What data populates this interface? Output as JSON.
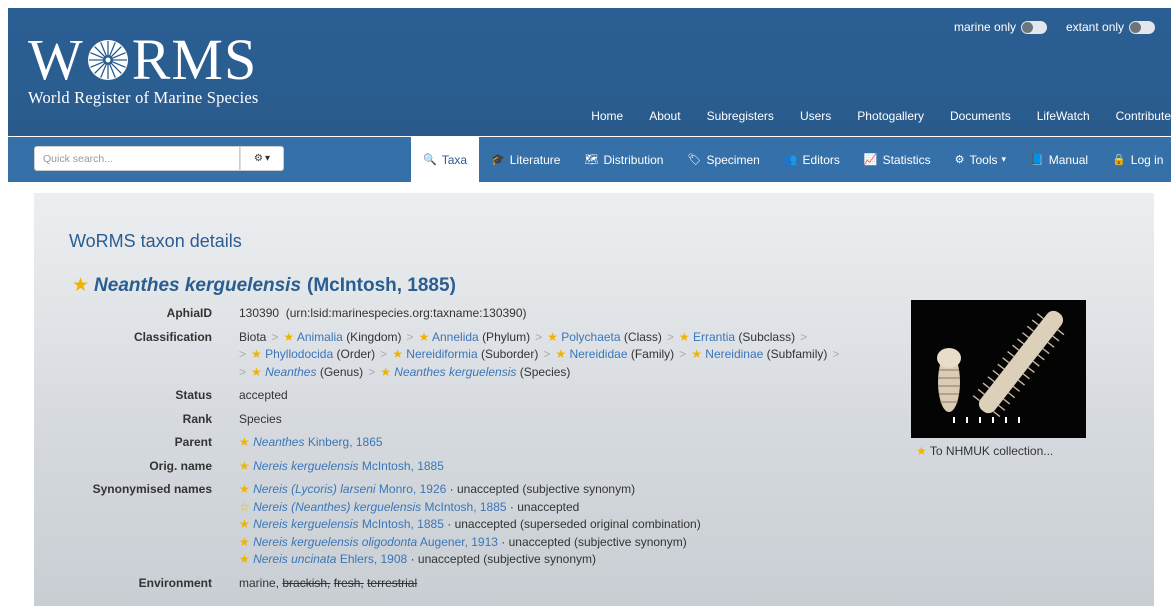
{
  "header": {
    "logo_wordmark_left": "W",
    "logo_wordmark_right": "RMS",
    "tagline": "World Register of Marine Species",
    "toggles": [
      {
        "label": "marine only"
      },
      {
        "label": "extant only"
      }
    ],
    "top_nav": [
      "Home",
      "About",
      "Subregisters",
      "Users",
      "Photogallery",
      "Documents",
      "LifeWatch",
      "Contribute"
    ]
  },
  "subbar": {
    "search_placeholder": "Quick search...",
    "search_options_label": "▾",
    "tabs": [
      {
        "label": "Taxa",
        "icon": "search-icon",
        "glyph": "🔍",
        "active": true
      },
      {
        "label": "Literature",
        "icon": "graduation-cap-icon",
        "glyph": "🎓",
        "active": false
      },
      {
        "label": "Distribution",
        "icon": "map-icon",
        "glyph": "🗺",
        "active": false
      },
      {
        "label": "Specimen",
        "icon": "tag-icon",
        "glyph": "🏷",
        "active": false
      },
      {
        "label": "Editors",
        "icon": "users-icon",
        "glyph": "👥",
        "active": false
      },
      {
        "label": "Statistics",
        "icon": "line-chart-icon",
        "glyph": "📈",
        "active": false
      },
      {
        "label": "Tools",
        "icon": "cogs-icon",
        "glyph": "⚙",
        "active": false,
        "caret": "▾"
      },
      {
        "label": "Manual",
        "icon": "book-icon",
        "glyph": "📘",
        "active": false
      },
      {
        "label": "Log in",
        "icon": "lock-icon",
        "glyph": "🔒",
        "active": false
      }
    ]
  },
  "main": {
    "heading": "WoRMS taxon details",
    "taxon_name": "Neanthes kerguelensis",
    "taxon_authority": "(McIntosh, 1885)",
    "labels": {
      "aphiaid": "AphiaID",
      "classification": "Classification",
      "status": "Status",
      "rank": "Rank",
      "parent": "Parent",
      "orig_name": "Orig. name",
      "synonymised": "Synonymised names",
      "environment": "Environment"
    },
    "aphiaid": "130390",
    "lsid": "(urn:lsid:marinespecies.org:taxname:130390)",
    "classification": [
      {
        "name": "Biota",
        "rank": "",
        "link": false,
        "star": false
      },
      {
        "name": "Animalia",
        "rank": "(Kingdom)",
        "link": true,
        "star": true
      },
      {
        "name": "Annelida",
        "rank": "(Phylum)",
        "link": true,
        "star": true
      },
      {
        "name": "Polychaeta",
        "rank": "(Class)",
        "link": true,
        "star": true
      },
      {
        "name": "Errantia",
        "rank": "(Subclass)",
        "link": true,
        "star": true
      },
      {
        "name": "Phyllodocida",
        "rank": "(Order)",
        "link": true,
        "star": true
      },
      {
        "name": "Nereidiformia",
        "rank": "(Suborder)",
        "link": true,
        "star": true
      },
      {
        "name": "Nereididae",
        "rank": "(Family)",
        "link": true,
        "star": true
      },
      {
        "name": "Nereidinae",
        "rank": "(Subfamily)",
        "link": true,
        "star": true
      },
      {
        "name": "Neanthes",
        "rank": "(Genus)",
        "link": true,
        "star": true,
        "italic": true
      },
      {
        "name": "Neanthes kerguelensis",
        "rank": "(Species)",
        "link": true,
        "star": true,
        "italic": true
      }
    ],
    "status": "accepted",
    "rank": "Species",
    "parent": {
      "name": "Neanthes",
      "author": "Kinberg, 1865"
    },
    "orig_name": {
      "name": "Nereis kerguelensis",
      "author": "McIntosh, 1885"
    },
    "synonyms": [
      {
        "name": "Nereis (Lycoris) larseni",
        "author": "Monro, 1926",
        "status": "· unaccepted (subjective synonym)",
        "star": "full"
      },
      {
        "name": "Nereis (Neanthes) kerguelensis",
        "author": "McIntosh, 1885",
        "status": "· unaccepted",
        "star": "outline"
      },
      {
        "name": "Nereis kerguelensis",
        "author": "McIntosh, 1885",
        "status": "· unaccepted (superseded original combination)",
        "star": "full"
      },
      {
        "name": "Nereis kerguelensis oligodonta",
        "author": "Augener, 1913",
        "status": "· unaccepted (subjective synonym)",
        "star": "full"
      },
      {
        "name": "Nereis uncinata",
        "author": "Ehlers, 1908",
        "status": "· unaccepted (subjective synonym)",
        "star": "full"
      }
    ],
    "environment": {
      "active": "marine,",
      "inactive": [
        "brackish,",
        "fresh,",
        "terrestrial"
      ]
    },
    "photo_caption": "To NHMUK collection..."
  }
}
